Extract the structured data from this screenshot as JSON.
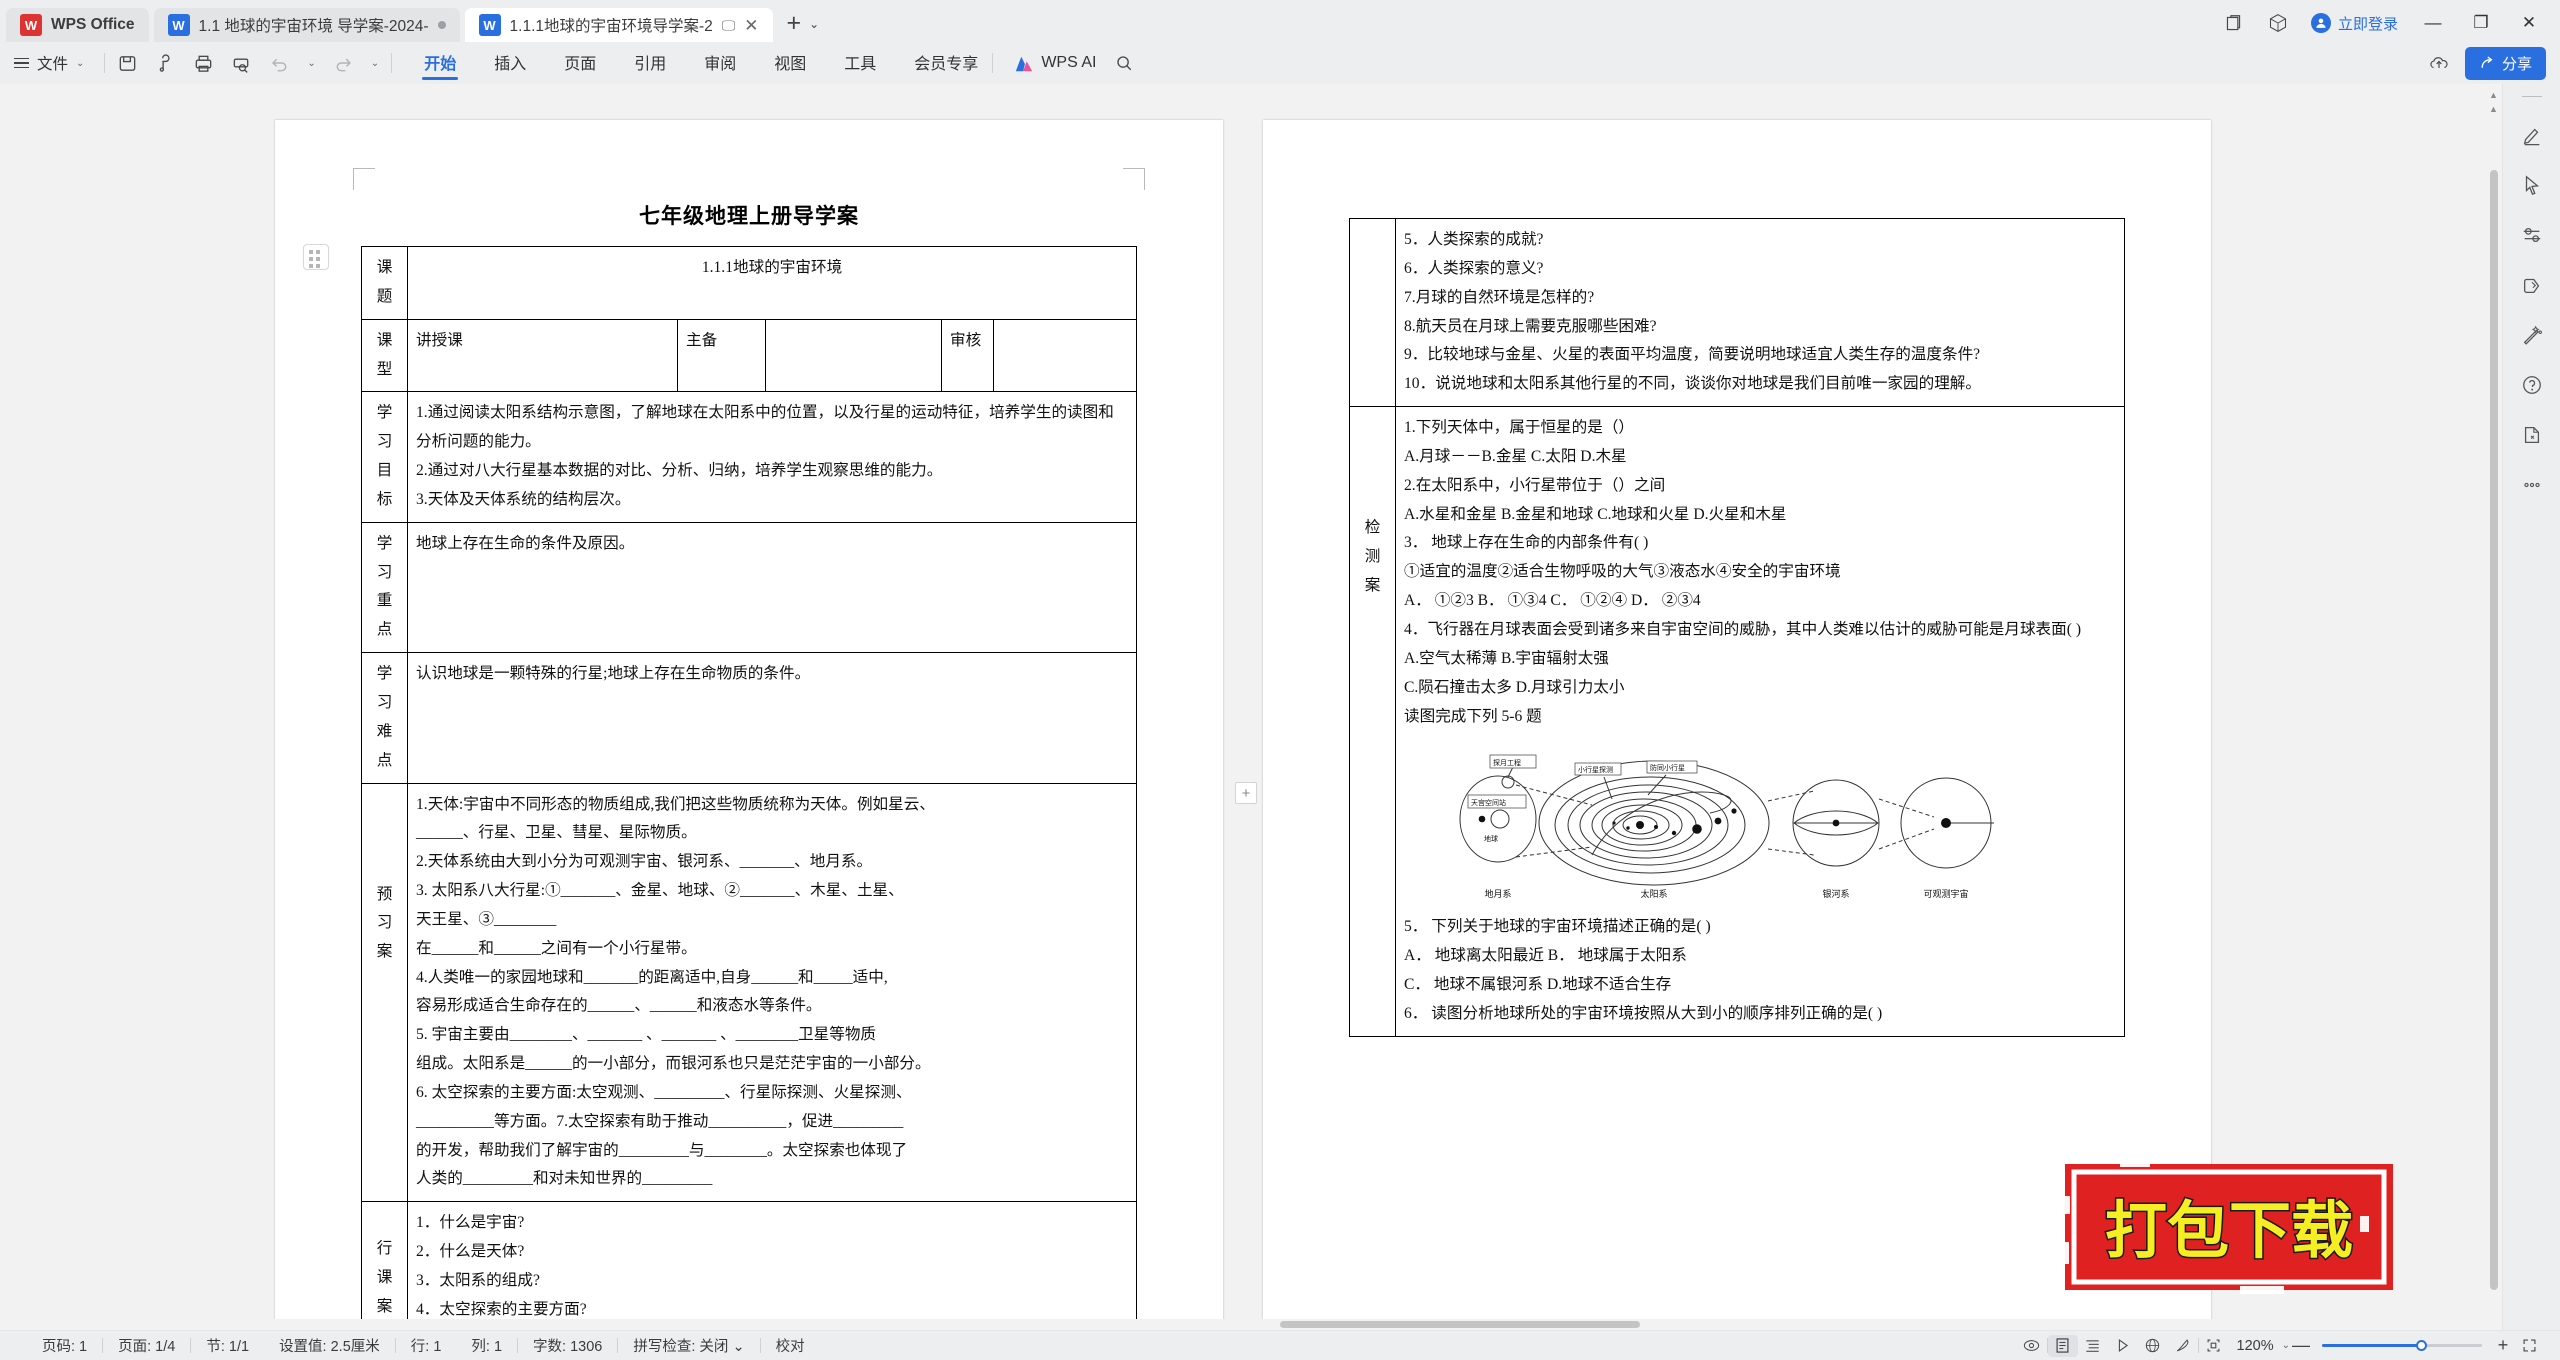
{
  "window": {
    "brand_tab": "WPS Office",
    "tabs": [
      {
        "label": "1.1 地球的宇宙环境 导学案-2024-",
        "state": "inactive"
      },
      {
        "label": "1.1.1地球的宇宙环境导学案-2",
        "state": "active"
      }
    ],
    "new_tab_label": "+",
    "login_label": "立即登录",
    "minimize": "—",
    "restore": "❐",
    "close": "✕"
  },
  "ribbon": {
    "file_label": "文件",
    "quick_icons": [
      "save-icon",
      "cloud-save-icon",
      "print-icon",
      "print-preview-icon",
      "undo-icon",
      "redo-icon",
      "customize-icon"
    ],
    "tabs": [
      {
        "label": "开始",
        "active": true
      },
      {
        "label": "插入",
        "active": false
      },
      {
        "label": "页面",
        "active": false
      },
      {
        "label": "引用",
        "active": false
      },
      {
        "label": "审阅",
        "active": false
      },
      {
        "label": "视图",
        "active": false
      },
      {
        "label": "工具",
        "active": false
      },
      {
        "label": "会员专享",
        "active": false
      }
    ],
    "ai_label": "WPS AI",
    "search_icon": "search-icon",
    "share_label": "分享",
    "upload_icon": "cloud-upload-icon"
  },
  "document": {
    "title": "七年级地理上册导学案",
    "rows": {
      "subject_label": "课题",
      "subject_value": "1.1.1地球的宇宙环境",
      "type_label": "课型",
      "type_value": "讲授课",
      "prep_label": "主备",
      "prep_value": "",
      "review_label": "审核",
      "review_value": "",
      "goal_label": [
        "学习",
        "目标"
      ],
      "goal_items": [
        "1.通过阅读太阳系结构示意图，了解地球在太阳系中的位置，以及行星的运动特征，培养学生的读图和分析问题的能力。",
        "2.通过对八大行星基本数据的对比、分析、归纳，培养学生观察思维的能力。",
        "3.天体及天体系统的结构层次。"
      ],
      "key_label": [
        "学习",
        "重点"
      ],
      "key_value": "地球上存在生命的条件及原因。",
      "hard_label": [
        "学习",
        "难点"
      ],
      "hard_value": "认识地球是一颗特殊的行星;地球上存在生命物质的条件。",
      "preview_label": [
        "预",
        "习",
        "案"
      ],
      "preview_items": [
        "1.天体:宇宙中不同形态的物质组成,我们把这些物质统称为天体。例如星云、",
        "______、行星、卫星、彗星、星际物质。",
        "2.天体系统由大到小分为可观测宇宙、银河系、_______、地月系。",
        "3. 太阳系八大行星:①_______、金星、地球、②_______、木星、土星、",
        "天王星、③________",
        "在______和______之间有一个小行星带。",
        "4.人类唯一的家园地球和_______的距离适中,自身______和_____适中,",
        "容易形成适合生命存在的______、______和液态水等条件。",
        "5. 宇宙主要由________、_______ 、_______ 、________卫星等物质",
        "组成。太阳系是______的一小部分，而银河系也只是茫茫宇宙的一小部分。",
        "6. 太空探索的主要方面:太空观测、_________、行星际探测、火星探测、",
        "__________等方面。7.太空探索有助于推动__________，促进_________",
        "的开发，帮助我们了解宇宙的_________与________。太空探索也体现了",
        "人类的_________和对未知世界的_________"
      ],
      "action_label": [
        "行",
        "课",
        "案"
      ],
      "action_items": [
        "1．什么是宇宙?",
        "2．什么是天体?",
        "3．太阳系的组成?",
        "4．太空探索的主要方面?"
      ]
    }
  },
  "document_page2": {
    "action_items_cont": [
      "5．人类探索的成就?",
      "6．人类探索的意义?",
      "7.月球的自然环境是怎样的?",
      "8.航天员在月球上需要克服哪些困难?",
      "9．比较地球与金星、火星的表面平均温度，简要说明地球适宜人类生存的温度条件?",
      "10．说说地球和太阳系其他行星的不同，谈谈你对地球是我们目前唯一家园的理解。"
    ],
    "test_label": [
      "检",
      "测",
      "案"
    ],
    "test_items": [
      "1.下列天体中，属于恒星的是（）",
      "A.月球－－B.金星 C.太阳 D.木星",
      "2.在太阳系中，小行星带位于（）之间",
      "A.水星和金星 B.金星和地球 C.地球和火星 D.火星和木星",
      "3． 地球上存在生命的内部条件有(      )",
      "①适宜的温度②适合生物呼吸的大气③液态水④安全的宇宙环境",
      "A． ①②3   B． ①③4   C． ①②④   D． ②③4",
      "4．飞行器在月球表面会受到诸多来自宇宙空间的威胁，其中人类难以估计的威胁可能是月球表面(        )",
      "A.空气太稀薄        B.宇宙辐射太强",
      "C.陨石撞击太多      D.月球引力太小",
      "读图完成下列 5-6 题"
    ],
    "test_items_after_figure": [
      "5． 下列关于地球的宇宙环境描述正确的是(      )",
      "A． 地球离太阳最近        B． 地球属于太阳系",
      "C． 地球不属银河系        D.地球不适合生存",
      "6． 读图分析地球所处的宇宙环境按照从大到小的顺序排列正确的是(        )"
    ],
    "figure": {
      "callouts": [
        "探月工程",
        "天宫空间站",
        "小行星探测",
        "防同小行星"
      ],
      "inner_labels": [
        "地球"
      ],
      "bottom_labels": [
        "地月系",
        "太阳系",
        "银河系",
        "可观测宇宙"
      ]
    }
  },
  "status_bar": {
    "items": [
      "页码: 1",
      "页面: 1/4",
      "节: 1/1",
      "设置值: 2.5厘米",
      "行: 1",
      "列: 1",
      "字数: 1306",
      "拼写检查: 关闭",
      "校对"
    ],
    "zoom": "120%",
    "view_icons": [
      "eye-icon",
      "page-view-icon",
      "outline-view-icon",
      "read-view-icon",
      "web-view-icon",
      "ink-icon",
      "fullscreen-view-icon"
    ],
    "zoom_out": "—",
    "zoom_in": "+",
    "expand_icon": "expand-icon"
  },
  "right_rail": {
    "icons": [
      "pen-icon",
      "cursor-icon",
      "sliders-icon",
      "eraser-icon",
      "magic-wand-icon",
      "help-icon",
      "doc-repair-icon",
      "more-icon"
    ]
  },
  "watermark": {
    "text": "打包下载",
    "bg_color": "#e02121",
    "text_color": "#f5ee22"
  },
  "colors": {
    "accent": "#2a6fe0",
    "toolbar_bg": "#eceef0",
    "canvas_bg": "#f2f2f2"
  }
}
